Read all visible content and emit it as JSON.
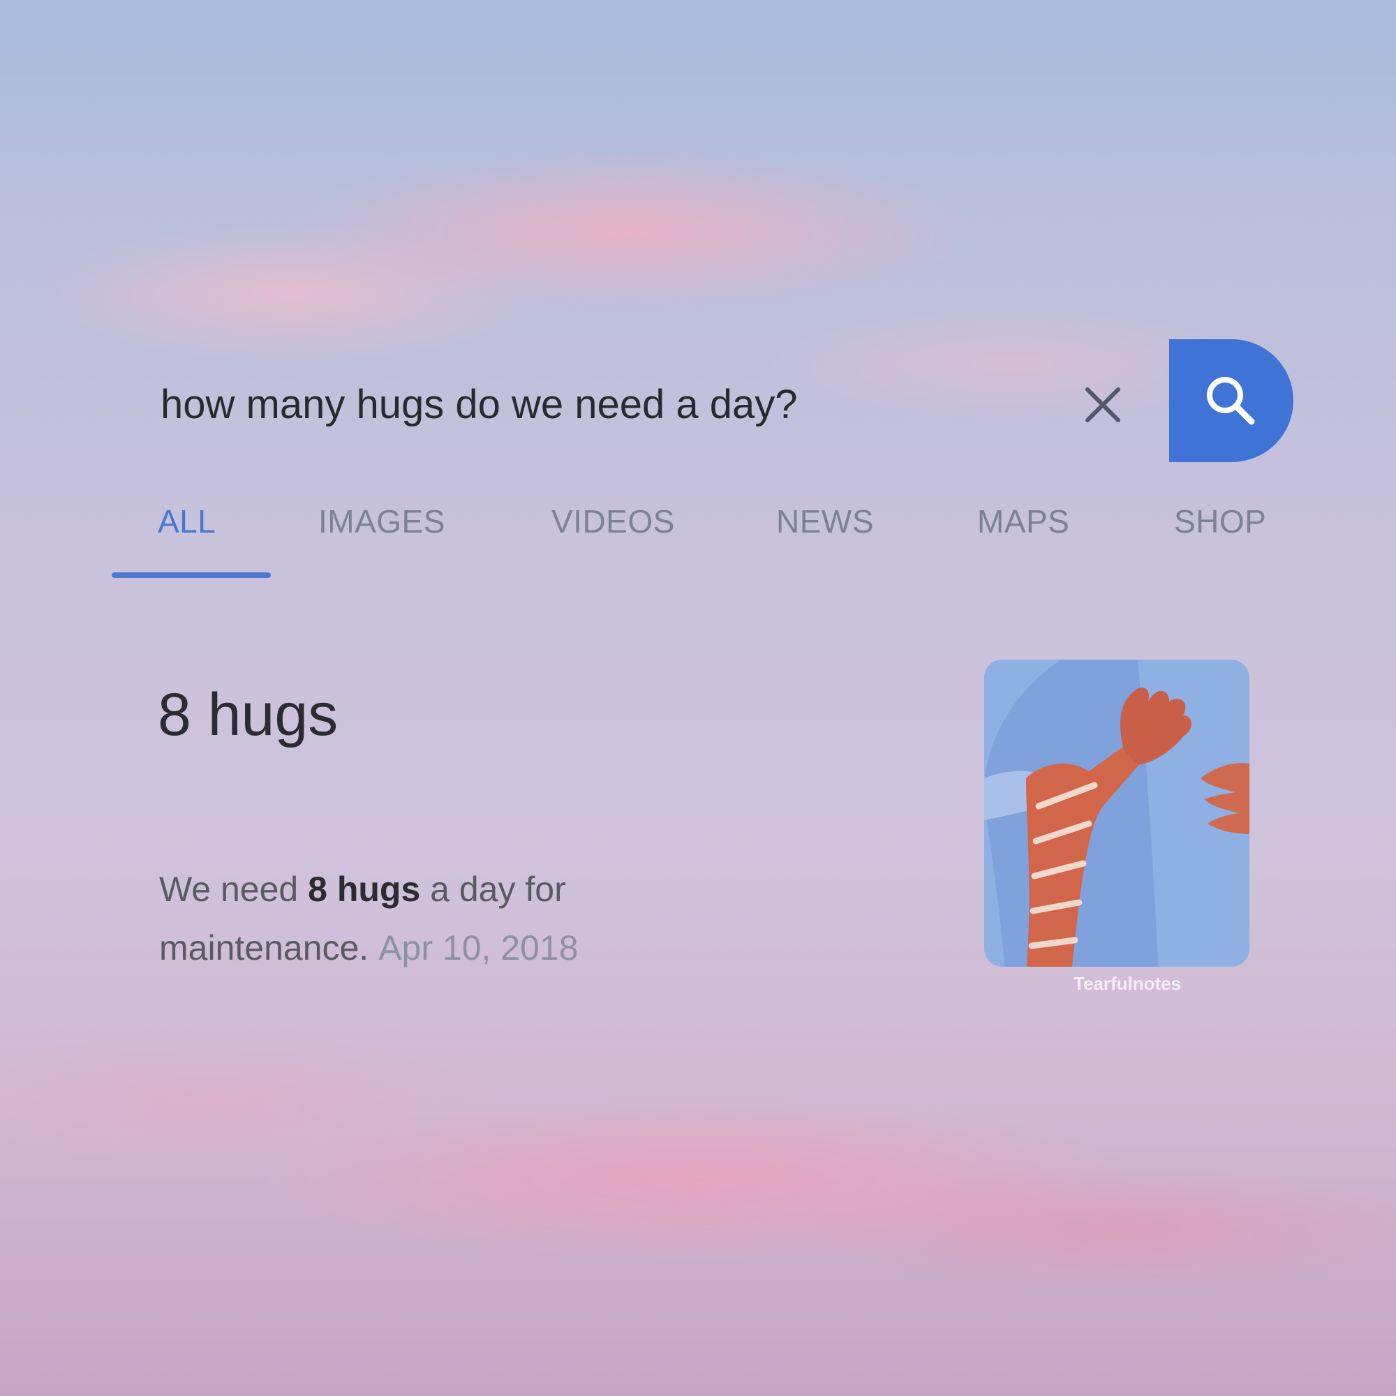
{
  "search": {
    "query": "how many hugs do we need a day?"
  },
  "tabs": [
    {
      "label": "ALL",
      "active": true
    },
    {
      "label": "IMAGES",
      "active": false
    },
    {
      "label": "VIDEOS",
      "active": false
    },
    {
      "label": "NEWS",
      "active": false
    },
    {
      "label": "MAPS",
      "active": false
    },
    {
      "label": "SHOP",
      "active": false
    }
  ],
  "answer": {
    "title": "8 hugs",
    "snippet_before": "We need ",
    "snippet_bold": "8 hugs",
    "snippet_after": " a day for maintenance.",
    "date": "Apr 10, 2018"
  },
  "thumbnail": {
    "watermark": "Tearfulnotes"
  },
  "colors": {
    "accent": "#3f74d6",
    "tab_active": "#4a78cf",
    "tab_inactive": "#7d8197"
  },
  "icons": {
    "clear": "close-icon",
    "search": "search-icon"
  }
}
